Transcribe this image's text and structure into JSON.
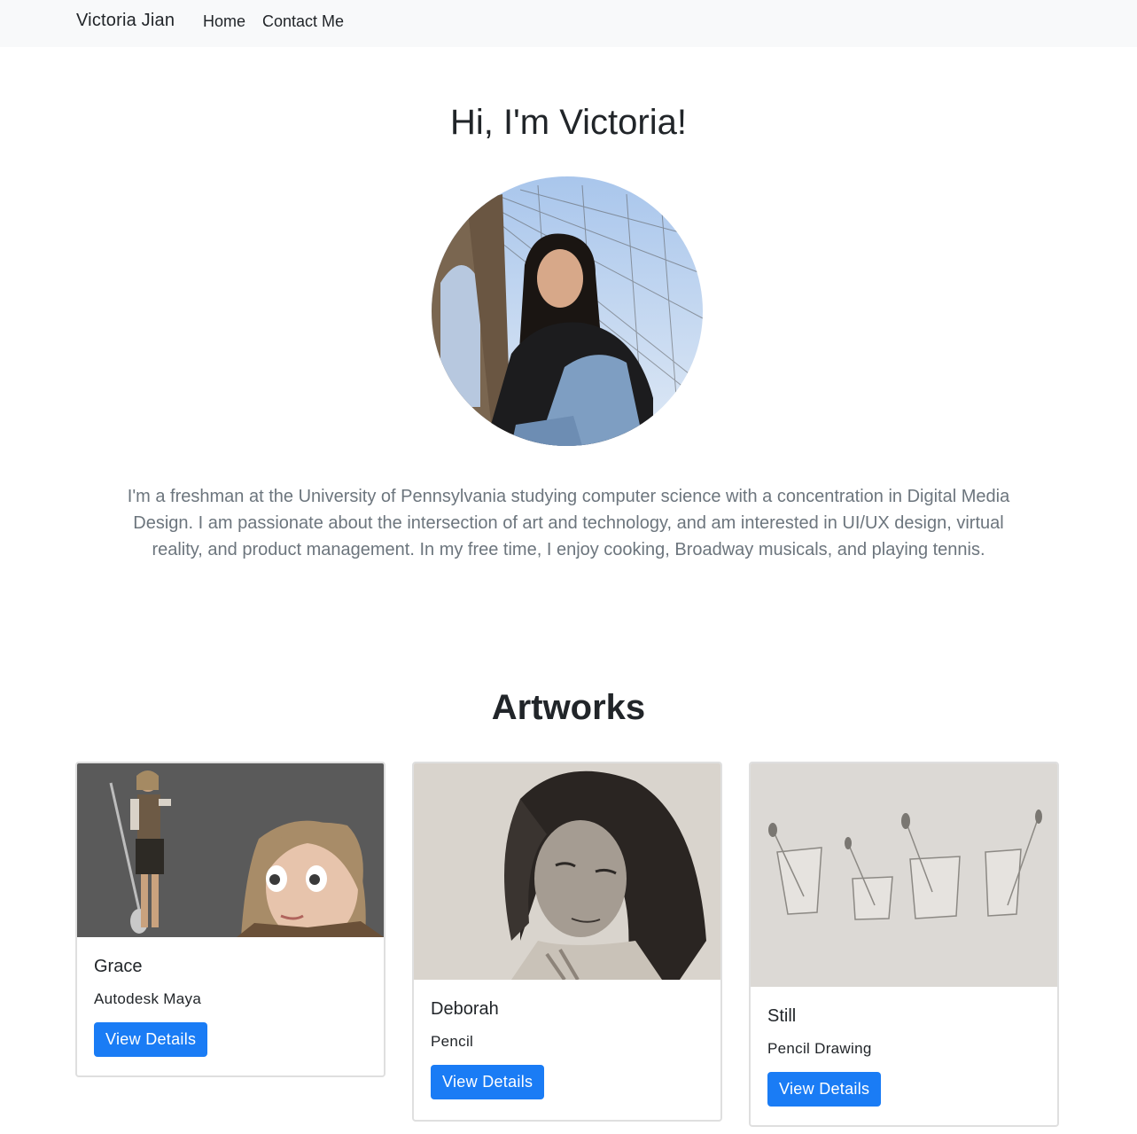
{
  "nav": {
    "brand": "Victoria Jian",
    "links": [
      "Home",
      "Contact Me"
    ]
  },
  "hero": {
    "title": "Hi, I'm Victoria!",
    "bio": "I'm a freshman at the University of Pennsylvania studying computer science with a concentration in Digital Media Design. I am passionate about the intersection of art and technology, and am interested in UI/UX design, virtual reality, and product management. In my free time, I enjoy cooking, Broadway musicals, and playing tennis."
  },
  "artworks": {
    "title": "Artworks",
    "items": [
      {
        "title": "Grace",
        "medium": "Autodesk Maya",
        "button": "View Details"
      },
      {
        "title": "Deborah",
        "medium": "Pencil",
        "button": "View Details"
      },
      {
        "title": "Still",
        "medium": "Pencil Drawing",
        "button": "View Details"
      }
    ]
  },
  "colors": {
    "navbar_bg": "#f8f9fa",
    "primary": "#1a7cf5",
    "muted_text": "#6c757d"
  }
}
